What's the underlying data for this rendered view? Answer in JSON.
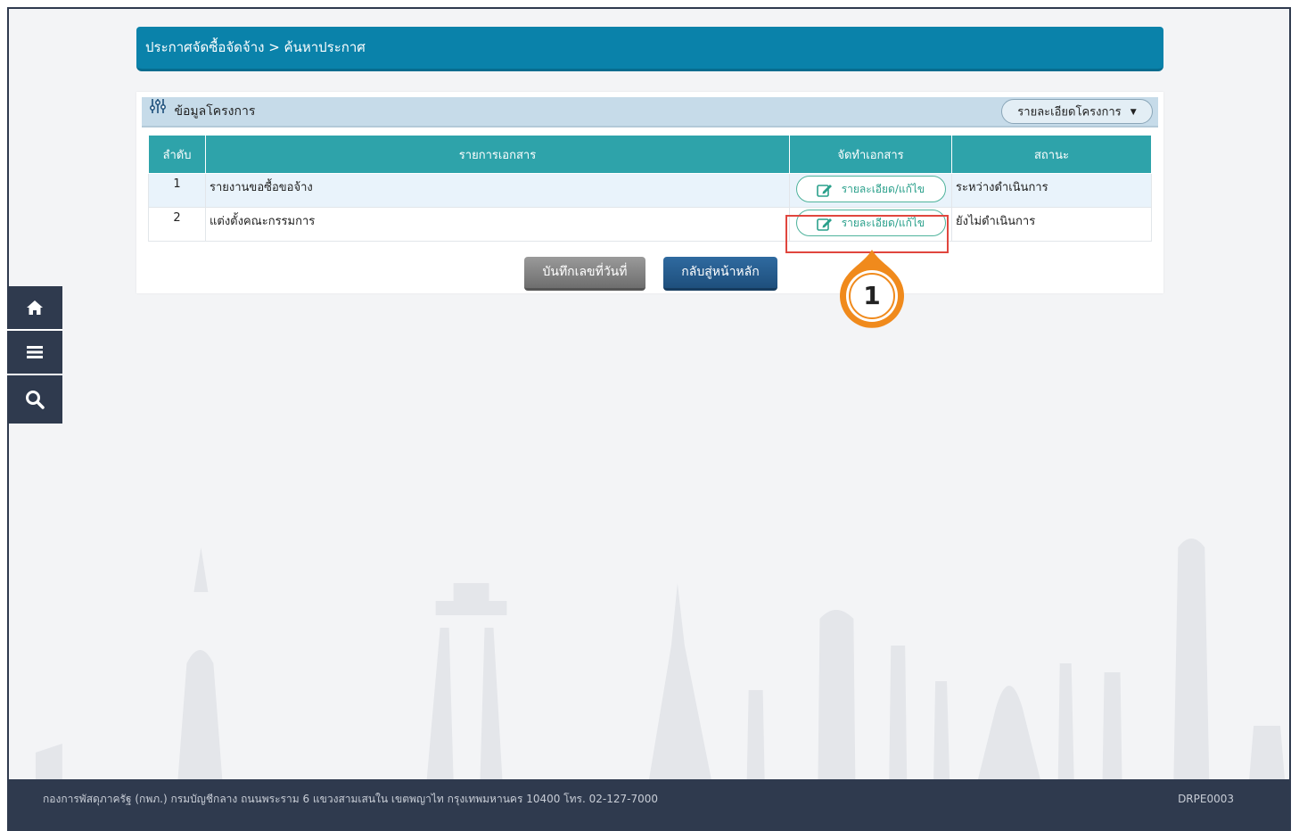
{
  "breadcrumb": {
    "text": "ประกาศจัดซื้อจัดจ้าง > ค้นหาประกาศ"
  },
  "panel": {
    "icon": "sliders-icon",
    "title": "ข้อมูลโครงการ",
    "dropdown_label": "รายละเอียดโครงการ"
  },
  "table": {
    "headers": [
      "ลำดับ",
      "รายการเอกสาร",
      "จัดทำเอกสาร",
      "สถานะ"
    ],
    "rows": [
      {
        "num": "1",
        "name": "รายงานขอซื้อขอจ้าง",
        "action": "รายละเอียด/แก้ไข",
        "status": "ระหว่างดำเนินการ"
      },
      {
        "num": "2",
        "name": "แต่งตั้งคณะกรรมการ",
        "action": "รายละเอียด/แก้ไข",
        "status": "ยังไม่ดำเนินการ"
      }
    ]
  },
  "buttons": {
    "save": "บันทึกเลขที่วันที่",
    "back": "กลับสู่หน้าหลัก"
  },
  "callout": {
    "number": "1"
  },
  "sidebar": {
    "items": [
      {
        "icon": "home-icon"
      },
      {
        "icon": "menu-icon"
      },
      {
        "icon": "search-icon"
      }
    ]
  },
  "footer": {
    "address": "กองการพัสดุภาครัฐ (กพภ.) กรมบัญชีกลาง ถนนพระราม 6 แขวงสามเสนใน เขตพญาไท กรุงเทพมหานคร 10400 โทร. 02-127-7000",
    "code": "DRPE0003"
  },
  "colors": {
    "header": "#0a82aa",
    "table_header": "#2ea3aa",
    "sidebar": "#2f3a4e",
    "highlight": "#e0463e",
    "callout": "#f08a1c"
  }
}
